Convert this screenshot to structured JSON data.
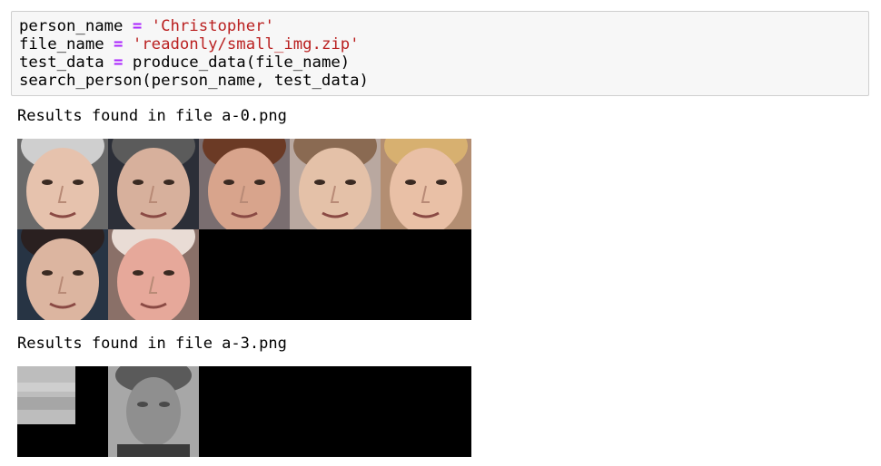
{
  "code_cell": {
    "prompt_fragment": ":",
    "lines": [
      {
        "var": "person_name",
        "op": "=",
        "value": "'Christopher'"
      },
      {
        "var": "file_name",
        "op": "=",
        "value": "'readonly/small_img.zip'"
      },
      {
        "var": "test_data",
        "op": "=",
        "value": "produce_data(file_name)"
      },
      {
        "call": "search_person(person_name, test_data)"
      }
    ]
  },
  "outputs": [
    {
      "label": "Results found in file a-0.png",
      "faces": [
        {
          "icon": "face-thumbnail-icon",
          "skin": "#e6c2ad",
          "hair": "#cfcfcf",
          "bg": "#6a6a6a"
        },
        {
          "icon": "face-thumbnail-icon",
          "skin": "#d7b09c",
          "hair": "#5b5b5b",
          "bg": "#2c2f38"
        },
        {
          "icon": "face-thumbnail-icon",
          "skin": "#d8a48c",
          "hair": "#6b3a25",
          "bg": "#7a6e70"
        },
        {
          "icon": "face-thumbnail-icon",
          "skin": "#e4c1a8",
          "hair": "#8a6a52",
          "bg": "#b9a8a0"
        },
        {
          "icon": "face-thumbnail-icon",
          "skin": "#e9c0a6",
          "hair": "#d7b070",
          "bg": "#b38e72"
        },
        {
          "icon": "face-thumbnail-icon",
          "skin": "#dcb5a0",
          "hair": "#2a2020",
          "bg": "#273444"
        },
        {
          "icon": "face-thumbnail-icon",
          "skin": "#e6a89a",
          "hair": "#e9dcd5",
          "bg": "#8a7068"
        }
      ]
    },
    {
      "label": "Results found in file a-3.png",
      "faces": [
        {
          "icon": "blurred-face-thumbnail-icon",
          "tone": "#bdbdbd"
        },
        {
          "icon": "blurred-face-thumbnail-icon",
          "tone": "#8f8f8f"
        }
      ]
    }
  ]
}
